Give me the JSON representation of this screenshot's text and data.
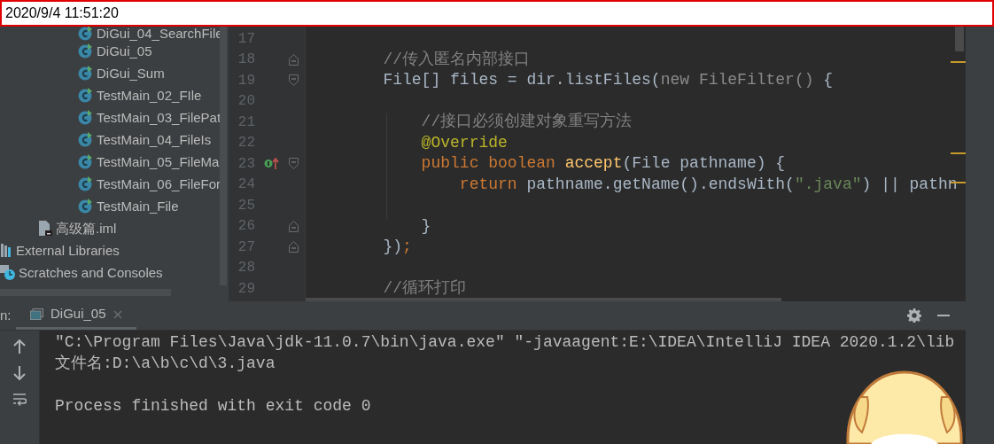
{
  "title_bar": {
    "text": "2020/9/4 11:51:20"
  },
  "project_tree": [
    {
      "children": [
        {
          "children": [
            {
              "label": "DiGui_04_SearchFile",
              "kind": "class"
            },
            {
              "label": "DiGui_05",
              "kind": "class"
            },
            {
              "label": "DiGui_Sum",
              "kind": "class"
            },
            {
              "label": "TestMain_02_FIle",
              "kind": "class"
            },
            {
              "label": "TestMain_03_FilePat",
              "kind": "class"
            },
            {
              "label": "TestMain_04_FileIs",
              "kind": "class"
            },
            {
              "label": "TestMain_05_FileMa",
              "kind": "class"
            },
            {
              "label": "TestMain_06_FileFor",
              "kind": "class"
            },
            {
              "label": "TestMain_File",
              "kind": "class"
            }
          ]
        },
        {
          "label": "高级篇.iml",
          "kind": "file"
        }
      ]
    },
    {
      "label": "External Libraries",
      "kind": "libraries"
    },
    {
      "label": "Scratches and Consoles",
      "kind": "scratches"
    }
  ],
  "editor": {
    "lines": [
      {
        "number": "17"
      },
      {
        "number": "18",
        "fold_end": true,
        "tokens": [
          {
            "kind": "comment",
            "text": "        //传入匿名内部接口"
          }
        ]
      },
      {
        "number": "19",
        "fold_start": true,
        "tokens": [
          {
            "kind": "plain",
            "text": "        File[] files = dir.listFiles("
          },
          {
            "kind": "muted",
            "text": "new FileFilter()"
          },
          {
            "kind": "plain",
            "text": " {"
          }
        ]
      },
      {
        "number": "20"
      },
      {
        "number": "21",
        "tokens": [
          {
            "kind": "comment",
            "text": "            //接口必须创建对象重写方法"
          }
        ]
      },
      {
        "number": "22",
        "tokens": [
          {
            "kind": "annotation",
            "text": "            @Override"
          }
        ]
      },
      {
        "number": "23",
        "fold_start": true,
        "implements": true,
        "tokens": [
          {
            "kind": "keyword",
            "text": "            public boolean "
          },
          {
            "kind": "method",
            "text": "accept"
          },
          {
            "kind": "plain",
            "text": "(File pathname) {"
          }
        ]
      },
      {
        "number": "24",
        "tokens": [
          {
            "kind": "keyword",
            "text": "                return "
          },
          {
            "kind": "plain",
            "text": "pathname.getName().endsWith("
          },
          {
            "kind": "string",
            "text": "\".java\""
          },
          {
            "kind": "plain",
            "text": ") || pathn"
          }
        ]
      },
      {
        "number": "25"
      },
      {
        "number": "26",
        "fold_end": true,
        "tokens": [
          {
            "kind": "plain",
            "text": "            }"
          }
        ]
      },
      {
        "number": "27",
        "fold_end": true,
        "tokens": [
          {
            "kind": "plain",
            "text": "        })"
          },
          {
            "kind": "keyword",
            "text": ";"
          }
        ]
      },
      {
        "number": "28"
      },
      {
        "number": "29",
        "tokens": [
          {
            "kind": "comment",
            "text": "        //循环打印"
          }
        ]
      }
    ]
  },
  "run_panel": {
    "label": "n:",
    "tabs": [
      {
        "label": "DiGui_05",
        "selected": true
      }
    ],
    "console": [
      {
        "kind": "output",
        "text": "\"C:\\Program Files\\Java\\jdk-11.0.7\\bin\\java.exe\" \"-javaagent:E:\\IDEA\\IntelliJ IDEA 2020.1.2\\lib"
      },
      {
        "kind": "output",
        "text": "文件名:D:\\a\\b\\c\\d\\3.java"
      },
      {
        "kind": "exit_status",
        "text": "Process finished with exit code 0"
      }
    ]
  }
}
